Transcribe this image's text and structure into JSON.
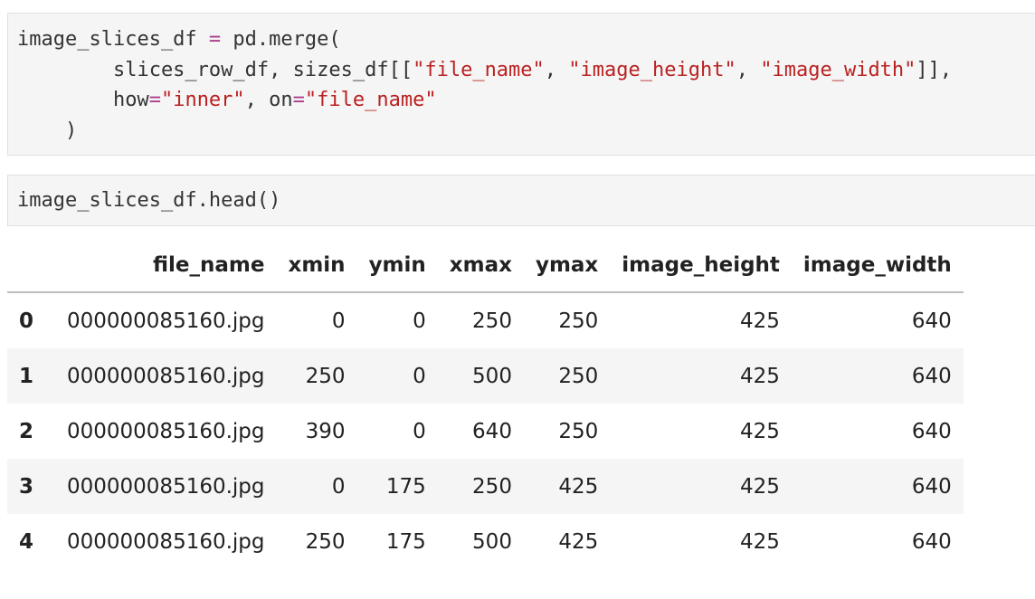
{
  "cells": [
    {
      "lines": [
        [
          {
            "t": "image_slices_df "
          },
          {
            "t": "=",
            "c": "op"
          },
          {
            "t": " pd.merge("
          }
        ],
        [
          {
            "t": "        slices_row_df, sizes_df[["
          },
          {
            "t": "\"file_name\"",
            "c": "str"
          },
          {
            "t": ", "
          },
          {
            "t": "\"image_height\"",
            "c": "str"
          },
          {
            "t": ", "
          },
          {
            "t": "\"image_width\"",
            "c": "str"
          },
          {
            "t": "]],"
          }
        ],
        [
          {
            "t": "        how"
          },
          {
            "t": "=",
            "c": "op"
          },
          {
            "t": "\"inner\"",
            "c": "str"
          },
          {
            "t": ", on"
          },
          {
            "t": "=",
            "c": "op"
          },
          {
            "t": "\"file_name\"",
            "c": "str"
          }
        ],
        [
          {
            "t": "    )"
          }
        ]
      ]
    },
    {
      "lines": [
        [
          {
            "t": "image_slices_df.head()"
          }
        ]
      ]
    }
  ],
  "table": {
    "columns": [
      "",
      "file_name",
      "xmin",
      "ymin",
      "xmax",
      "ymax",
      "image_height",
      "image_width"
    ],
    "rows": [
      [
        "0",
        "000000085160.jpg",
        "0",
        "0",
        "250",
        "250",
        "425",
        "640"
      ],
      [
        "1",
        "000000085160.jpg",
        "250",
        "0",
        "500",
        "250",
        "425",
        "640"
      ],
      [
        "2",
        "000000085160.jpg",
        "390",
        "0",
        "640",
        "250",
        "425",
        "640"
      ],
      [
        "3",
        "000000085160.jpg",
        "0",
        "175",
        "250",
        "425",
        "425",
        "640"
      ],
      [
        "4",
        "000000085160.jpg",
        "250",
        "175",
        "500",
        "425",
        "425",
        "640"
      ]
    ]
  }
}
